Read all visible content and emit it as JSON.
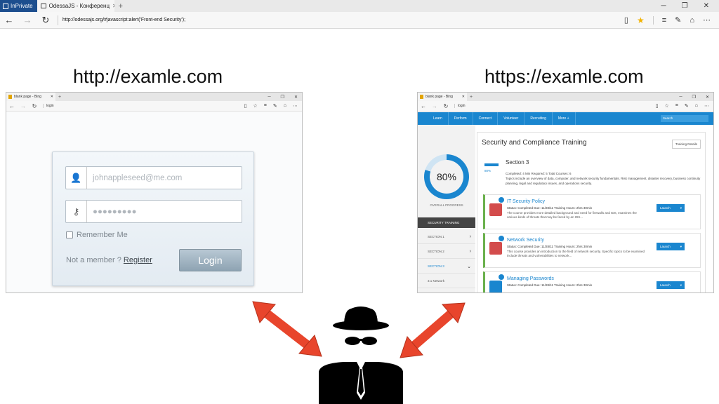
{
  "browser": {
    "inprivate_label": "InPrivate",
    "tab_title": "OdessaJS - Конференц",
    "address": "http://odessajs.org/#javascript:alert('Front-end Security');"
  },
  "captions": {
    "left": "http://examle.com",
    "right": "https://examle.com"
  },
  "mini_browser": {
    "tab_title": "blank page - Bing",
    "address": "login"
  },
  "login_form": {
    "email_placeholder": "johnappleseed@me.com",
    "password_placeholder": "●●●●●●●●●",
    "remember_label": "Remember Me",
    "not_member_text": "Not a member ? ",
    "register_link": "Register",
    "login_button": "Login"
  },
  "training": {
    "nav": [
      "Learn",
      "Perform",
      "Connect",
      "Volunteer",
      "Recruiting",
      "More +"
    ],
    "search_placeholder": "Search",
    "progress_value": "80%",
    "overall_label": "OVERALL PROGRESS",
    "sidebar": [
      {
        "label": "SECURITY TRAINING"
      },
      {
        "label": "SECTION 1"
      },
      {
        "label": "SECTION 2"
      },
      {
        "label": "SECTION 3"
      },
      {
        "label": "3.1 Network"
      }
    ],
    "title": "Security and Compliance Training",
    "details_button": "Training Details",
    "section_title": "Section 3",
    "section_pct": "80%",
    "section_stats": "Completed: 4   Min Required: 5   Total Courses: 6",
    "section_desc": "Topics include an overview of data, computer, and network security fundamentals. Risk management, disaster recovery, business continuity planning, legal and regulatory issues, and operations security.",
    "courses": [
      {
        "name": "IT Security Policy",
        "meta": "Status: Completed   Due: 11/28/11   Training Hours: 2hrs 30min",
        "desc": "The course provides more detailed background and need for firewalls and IDS, examines the various kinds of threats that may be faced by an IDS...",
        "launch": "Launch"
      },
      {
        "name": "Network Security",
        "meta": "Status: Completed   Due: 11/28/11   Training Hours: 2hrs 30min",
        "desc": "This course provides an introduction to the field of network security. Specific topics to be examined include threats and vulnerabilities to network...",
        "launch": "Launch"
      },
      {
        "name": "Managing Passwords",
        "meta": "Status: Completed   Due: 11/28/11   Training Hours: 2hrs 30min",
        "desc": "",
        "launch": "Launch"
      }
    ]
  },
  "colors": {
    "arrow": "#e8452c",
    "silhouette": "#000000",
    "accent_blue": "#1a86cf"
  }
}
